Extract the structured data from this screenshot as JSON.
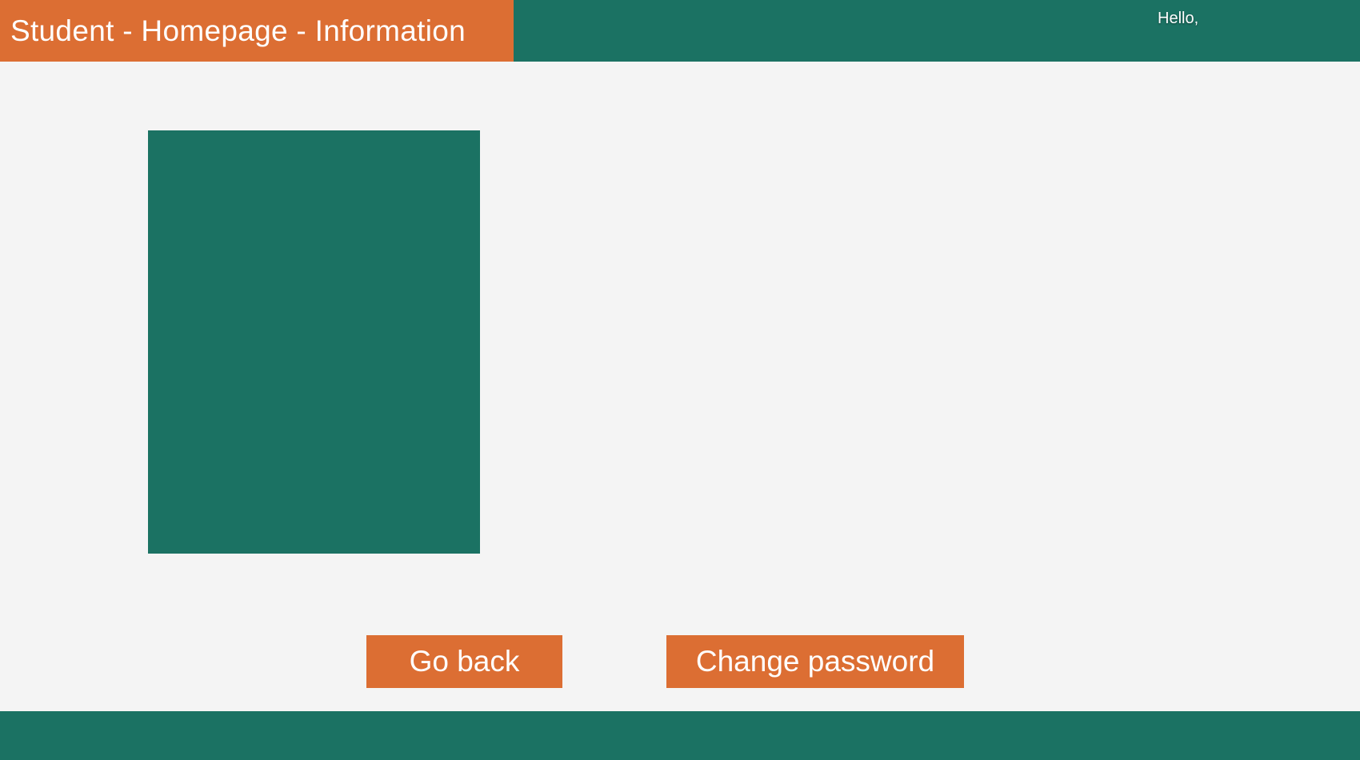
{
  "header": {
    "title": "Student - Homepage - Information",
    "greeting": "Hello,"
  },
  "actions": {
    "go_back_label": "Go back",
    "change_password_label": "Change password"
  },
  "colors": {
    "primary": "#1b7263",
    "accent": "#dc6e33",
    "background": "#f4f4f4",
    "text_on_color": "#ffffff"
  }
}
